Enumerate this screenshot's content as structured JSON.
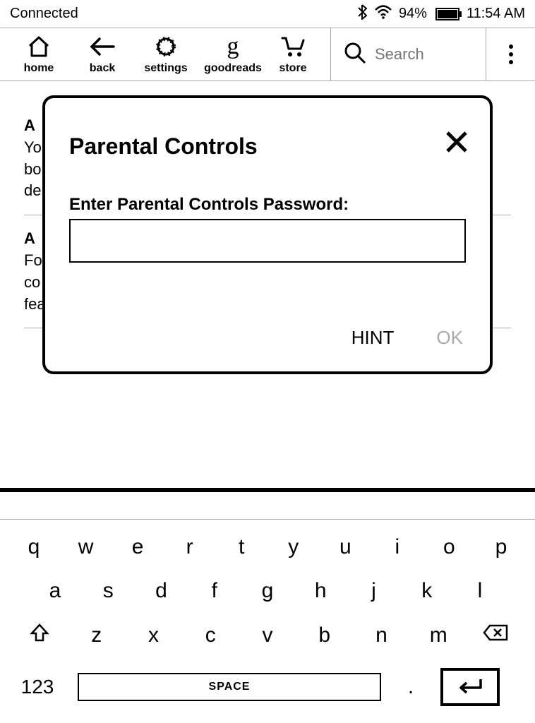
{
  "status": {
    "connection": "Connected",
    "battery_pct": "94%",
    "time": "11:54 AM"
  },
  "toolbar": {
    "home": "home",
    "back": "back",
    "settings": "settings",
    "goodreads": "goodreads",
    "store": "store",
    "search_placeholder": "Search"
  },
  "bg": {
    "s1_title": "A",
    "s1_line1": "Yo",
    "s1_line2": "bo",
    "s1_line3": "de",
    "s2_title": "A",
    "s2_line1": "Fo",
    "s2_line2": "co",
    "s2_line3": "fea"
  },
  "modal": {
    "title": "Parental Controls",
    "label": "Enter Parental Controls Password:",
    "hint": "HINT",
    "ok": "OK"
  },
  "keyboard": {
    "row1": [
      "q",
      "w",
      "e",
      "r",
      "t",
      "y",
      "u",
      "i",
      "o",
      "p"
    ],
    "row2": [
      "a",
      "s",
      "d",
      "f",
      "g",
      "h",
      "j",
      "k",
      "l"
    ],
    "row3": [
      "z",
      "x",
      "c",
      "v",
      "b",
      "n",
      "m"
    ],
    "k123": "123",
    "space": "SPACE",
    "period": "."
  }
}
